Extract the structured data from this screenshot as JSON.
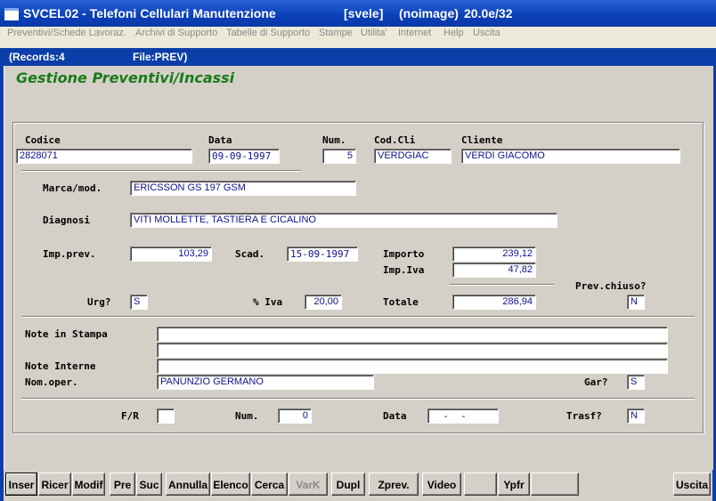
{
  "window": {
    "title": "SVCEL02 - Telefoni Cellulari Manutenzione",
    "user": "[svele]",
    "image_mode": "(noimage)",
    "version": "20.0e/32"
  },
  "menu": [
    "Preventivi/Schede Lavoraz.",
    "Archivi di Supporto",
    "Tabelle di Supporto",
    "Stampe",
    "Utilita'",
    "Internet",
    "Help",
    "Uscita"
  ],
  "status": {
    "records": "(Records:4",
    "file": "File:PREV)"
  },
  "form": {
    "heading": "Gestione Preventivi/Incassi",
    "codice": {
      "label": "Codice",
      "value": "2828071"
    },
    "data": {
      "label": "Data",
      "value": "09-09-1997"
    },
    "num": {
      "label": "Num.",
      "value": "5"
    },
    "codcli": {
      "label": "Cod.Cli",
      "value": "VERDGIAC"
    },
    "cliente": {
      "label": "Cliente",
      "value": "VERDI GIACOMO"
    },
    "marca": {
      "label": "Marca/mod.",
      "value": "ERICSSON GS 197 GSM"
    },
    "diagnosi": {
      "label": "Diagnosi",
      "value": "VITI MOLLETTE, TASTIERA E CICALINO"
    },
    "impprev": {
      "label": "Imp.prev.",
      "value": "103,29"
    },
    "scad": {
      "label": "Scad.",
      "value": "15-09-1997"
    },
    "importo": {
      "label": "Importo",
      "value": "239,12"
    },
    "impiva": {
      "label": "Imp.Iva",
      "value": "47,82"
    },
    "prevchiuso": {
      "label": "Prev.chiuso?",
      "value": "N"
    },
    "urg": {
      "label": "Urg?",
      "value": "S"
    },
    "iva": {
      "label": "% Iva",
      "value": "20,00"
    },
    "totale": {
      "label": "Totale",
      "value": "286,94"
    },
    "note_stampa": {
      "label": "Note in Stampa",
      "line1": "",
      "line2": ""
    },
    "note_interne": {
      "label": "Note Interne",
      "value": ""
    },
    "nomoper": {
      "label": "Nom.oper.",
      "value": "PANUNZIO GERMANO"
    },
    "gar": {
      "label": "Gar?",
      "value": "S"
    },
    "fr": {
      "label": "F/R",
      "value": ""
    },
    "num2": {
      "label": "Num.",
      "value": "0"
    },
    "data2": {
      "label": "Data",
      "value": "  -  -"
    },
    "trasf": {
      "label": "Trasf?",
      "value": "N"
    }
  },
  "buttons": {
    "inser": "Inser",
    "ricer": "Ricer",
    "modif": "Modif",
    "pre": "Pre",
    "suc": "Suc",
    "annulla": "Annulla",
    "elenco": "Elenco",
    "cerca": "Cerca",
    "vark": "VarK",
    "dupl": "Dupl",
    "zprev": "Zprev.",
    "video": "Video",
    "blank1": "",
    "ypfr": "Ypfr",
    "blank2": "",
    "uscita": "Uscita"
  }
}
